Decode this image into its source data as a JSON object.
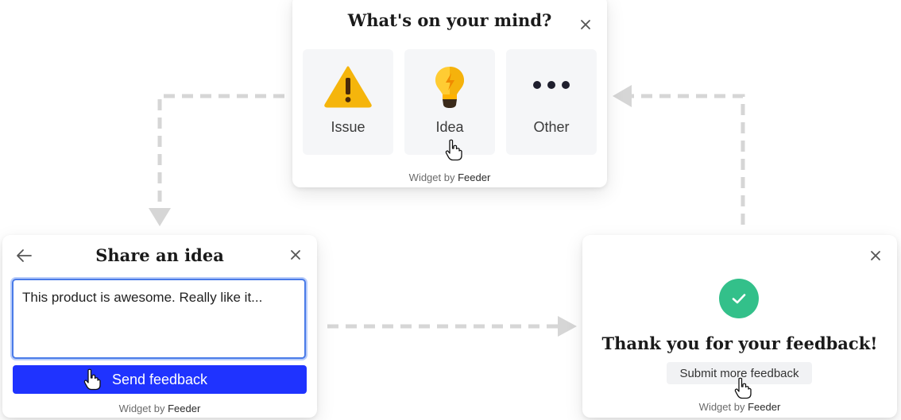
{
  "colors": {
    "accent": "#1f33ff",
    "success": "#33c08a",
    "focus_border": "#4a7be8",
    "option_bg": "#f5f6f8",
    "arrow": "#d6d6d6"
  },
  "mind_widget": {
    "title": "What's on your mind?",
    "close_icon": "close-icon",
    "options": [
      {
        "label": "Issue",
        "icon": "warning-icon"
      },
      {
        "label": "Idea",
        "icon": "lightbulb-icon"
      },
      {
        "label": "Other",
        "icon": "more-dots-icon"
      }
    ],
    "credit_prefix": "Widget by",
    "credit_brand": "Feeder"
  },
  "idea_widget": {
    "title": "Share an idea",
    "back_icon": "arrow-left-icon",
    "close_icon": "close-icon",
    "textarea_value": "This product is awesome. Really like it...",
    "send_label": "Send feedback",
    "credit_prefix": "Widget by",
    "credit_brand": "Feeder"
  },
  "thanks_widget": {
    "title": "Thank you for your feedback!",
    "check_icon": "check-icon",
    "close_icon": "close-icon",
    "more_label": "Submit more feedback",
    "credit_prefix": "Widget by",
    "credit_brand": "Feeder"
  }
}
